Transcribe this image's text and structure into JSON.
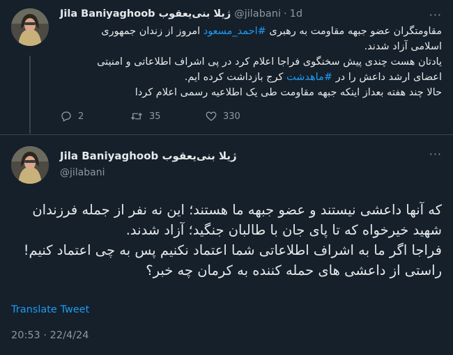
{
  "parent_tweet": {
    "author_name": "Jila Baniyaghoob ژیلا بنی‌یعقوب",
    "author_handle": "@jilabani",
    "age": "1d",
    "dot": "·",
    "more": "···",
    "lines": [
      {
        "pre": "مقاومتگران عضو جبهه مقاومت به رهبری ",
        "link": "#احمد_مسعود",
        "post": " امروز از زندان جمهوری"
      },
      {
        "pre": "اسلامی آزاد شدند.",
        "link": "",
        "post": ""
      },
      {
        "pre": "یادتان هست چندی پیش سخنگوی فراجا اعلام کرد در پی اشراف اطلاعاتی و امنیتی",
        "link": "",
        "post": ""
      },
      {
        "pre": "اعضای ارشد داعش را در ",
        "link": "#ماهدشت",
        "post": " کرج بازداشت کرده ایم."
      },
      {
        "pre": "حالا چند هفته بعداز اینکه جبهه مقاومت طی یک اطلاعیه رسمی اعلام کردا",
        "link": "",
        "post": ""
      }
    ],
    "replies": "2",
    "retweets": "35",
    "likes": "330"
  },
  "main_tweet": {
    "author_name": "Jila Baniyaghoob ژیلا بنی‌یعقوب",
    "author_handle": "@jilabani",
    "more": "···",
    "lines": [
      "که آنها داعشی نیستند و عضو جبهه ما هستند؛ این نه نفر از جمله فرزندان",
      "شهید خیرخواه که تا پای جان با طالبان جنگید؛ آزاد شدند.",
      "فراجا اگر ما به اشراف اطلاعاتی شما اعتماد نکنیم پس به چی اعتماد کنیم!",
      "راستی از داعشی های حمله کننده به کرمان چه خبر؟"
    ],
    "translate_label": "Translate Tweet",
    "timestamp": "20:53 · 22/4/24"
  },
  "icons": {
    "reply": "reply-icon",
    "retweet": "retweet-icon",
    "like": "heart-icon",
    "more": "more-icon"
  },
  "colors": {
    "background": "#15202b",
    "text": "#e7e9ea",
    "muted": "#8b98a5",
    "link": "#1d9bf0",
    "divider": "#38444d"
  }
}
